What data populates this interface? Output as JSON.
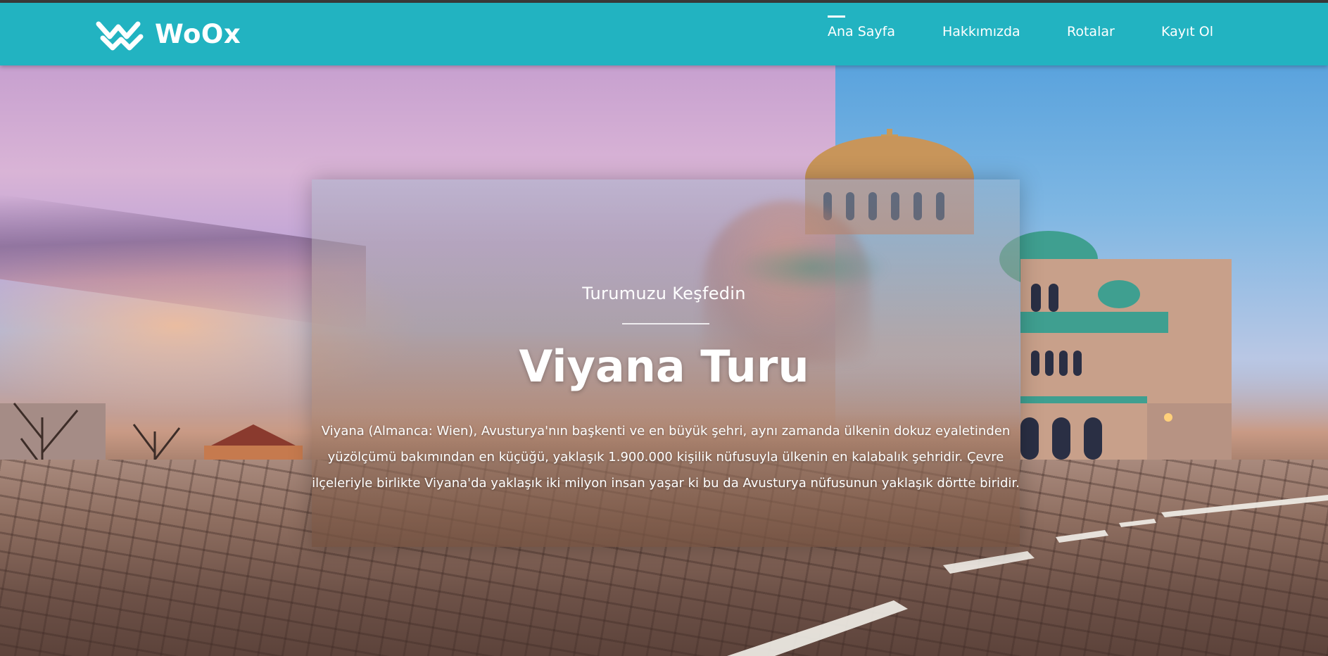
{
  "brand": {
    "name": "WoOx",
    "logo_icon": "woox-double-check-icon"
  },
  "nav": {
    "items": [
      {
        "label": "Ana Sayfa",
        "active": true
      },
      {
        "label": "Hakkımızda",
        "active": false
      },
      {
        "label": "Rotalar",
        "active": false
      },
      {
        "label": "Kayıt Ol",
        "active": false
      }
    ]
  },
  "hero": {
    "subtitle": "Turumuzu Keşfedin",
    "title": "Viyana Turu",
    "description": "Viyana (Almanca: Wien), Avusturya'nın başkenti ve en büyük şehri, aynı zamanda ülkenin dokuz eyaletinden yüzölçümü bakımından en küçüğü, yaklaşık 1.900.000 kişilik nüfusuyla ülkenin en kalabalık şehridir. Çevre ilçeleriyle birlikte Viyana'da yaklaşık iki milyon insan yaşar ki bu da Avusturya nüfusunun yaklaşık dörtte biridir.",
    "background_image": "cathedral-square-sunset-photo"
  },
  "colors": {
    "navbar": "#22b3c1",
    "text": "#ffffff"
  }
}
